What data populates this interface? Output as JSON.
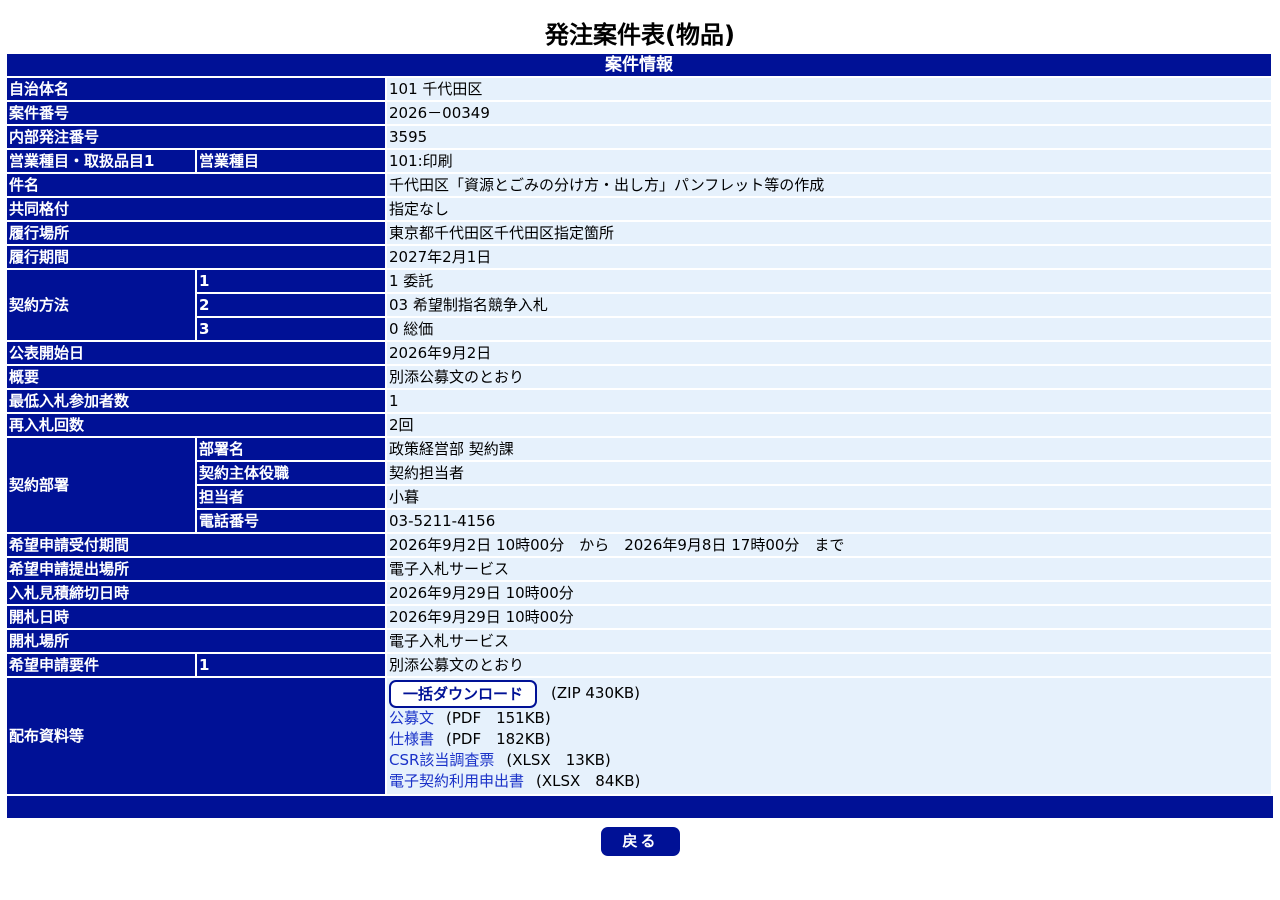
{
  "page": {
    "title": "発注案件表(物品)",
    "section_header": "案件情報",
    "back_label": "戻る"
  },
  "rows": {
    "municipality": {
      "label": "自治体名",
      "value": "101 千代田区"
    },
    "case_number": {
      "label": "案件番号",
      "value": "2026－00349"
    },
    "internal_order_number": {
      "label": "内部発注番号",
      "value": "3595"
    },
    "business_category": {
      "label": "営業種目・取扱品目1",
      "sub_label": "営業種目",
      "value": "101:印刷"
    },
    "subject": {
      "label": "件名",
      "value": "千代田区「資源とごみの分け方・出し方」パンフレット等の作成"
    },
    "joint_rating": {
      "label": "共同格付",
      "value": "指定なし"
    },
    "place_of_performance": {
      "label": "履行場所",
      "value": "東京都千代田区千代田区指定箇所"
    },
    "period_of_performance": {
      "label": "履行期間",
      "value": "2027年2月1日"
    },
    "contract_method": {
      "label": "契約方法",
      "items": [
        {
          "num": "1",
          "value": "1 委託"
        },
        {
          "num": "2",
          "value": "03 希望制指名競争入札"
        },
        {
          "num": "3",
          "value": "0 総価"
        }
      ]
    },
    "publication_start": {
      "label": "公表開始日",
      "value": "2026年9月2日"
    },
    "overview": {
      "label": "概要",
      "value": "別添公募文のとおり"
    },
    "min_bidders": {
      "label": "最低入札参加者数",
      "value": "1"
    },
    "rebid_count": {
      "label": "再入札回数",
      "value": "2回"
    },
    "contract_department": {
      "label": "契約部署",
      "items": [
        {
          "sub_label": "部署名",
          "value": "政策経営部 契約課"
        },
        {
          "sub_label": "契約主体役職",
          "value": "契約担当者"
        },
        {
          "sub_label": "担当者",
          "value": "小暮"
        },
        {
          "sub_label": "電話番号",
          "value": "03-5211-4156"
        }
      ]
    },
    "application_period": {
      "label": "希望申請受付期間",
      "value": "2026年9月2日 10時00分　から　2026年9月8日 17時00分　まで"
    },
    "application_place": {
      "label": "希望申請提出場所",
      "value": "電子入札サービス"
    },
    "bid_deadline": {
      "label": "入札見積締切日時",
      "value": "2026年9月29日 10時00分"
    },
    "opening_datetime": {
      "label": "開札日時",
      "value": "2026年9月29日 10時00分"
    },
    "opening_place": {
      "label": "開札場所",
      "value": "電子入札サービス"
    },
    "application_requirements": {
      "label": "希望申請要件",
      "num": "1",
      "value": "別添公募文のとおり"
    },
    "distributed_materials": {
      "label": "配布資料等",
      "bulk_download_label": "一括ダウンロード",
      "bulk_download_meta": "(ZIP 430KB)",
      "files": [
        {
          "name": "公募文",
          "meta": "(PDF　151KB)"
        },
        {
          "name": "仕様書",
          "meta": "(PDF　182KB)"
        },
        {
          "name": "CSR該当調査票",
          "meta": "(XLSX　13KB)"
        },
        {
          "name": "電子契約利用申出書",
          "meta": "(XLSX　84KB)"
        }
      ]
    }
  },
  "colors": {
    "header_blue": "#001196",
    "value_background": "#e6f1fc",
    "link": "#1a32c8"
  }
}
